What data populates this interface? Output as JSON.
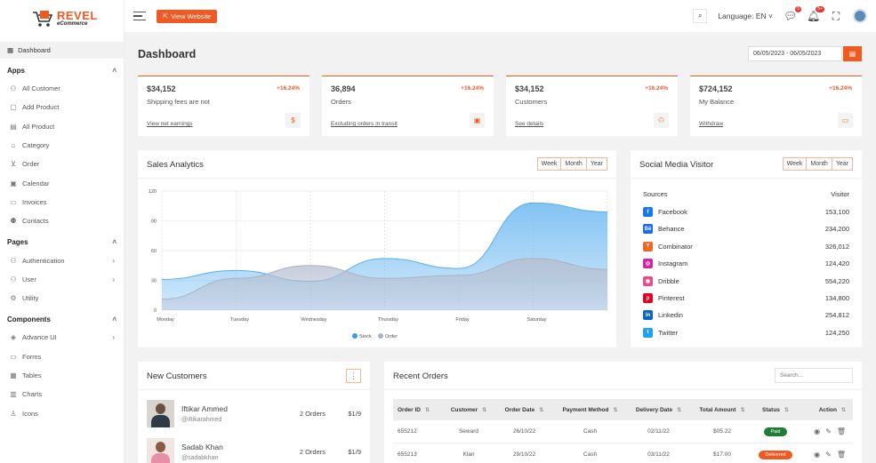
{
  "brand": {
    "name": "REVEL",
    "sub": "eCommerce"
  },
  "topbar": {
    "view_website": "View Website",
    "language_label": "Language:",
    "language_value": "EN",
    "messages_badge": "5",
    "notifications_badge": "5+"
  },
  "sidebar": {
    "dashboard": "Dashboard",
    "apps_title": "Apps",
    "apps": [
      "All Customer",
      "Add Product",
      "All Product",
      "Category",
      "Order",
      "Calendar",
      "Invoices",
      "Contacts"
    ],
    "pages_title": "Pages",
    "pages": [
      "Authentication",
      "User",
      "Utility"
    ],
    "components_title": "Components",
    "components": [
      "Advance UI",
      "Forms",
      "Tables",
      "Charts",
      "Icons"
    ]
  },
  "page": {
    "title": "Dashboard",
    "date_range": "06/05/2023 - 06/05/2023"
  },
  "stats": [
    {
      "value": "$34,152",
      "change": "+16.24%",
      "desc": "Shipping fees are not",
      "link": "View net earnings"
    },
    {
      "value": "36,894",
      "change": "+16.24%",
      "desc": "Orders",
      "link": "Excluding orders in transit"
    },
    {
      "value": "$34,152",
      "change": "+16.24%",
      "desc": "Customers",
      "link": "See details"
    },
    {
      "value": "$724,152",
      "change": "+16.24%",
      "desc": "My Balance",
      "link": "Withdraw"
    }
  ],
  "analytics": {
    "title": "Sales Analytics",
    "ranges": [
      "Week",
      "Month",
      "Year"
    ]
  },
  "chart_data": {
    "type": "area",
    "title": "Sales Analytics",
    "categories": [
      "Monday",
      "Tuesday",
      "Wednesday",
      "Thursday",
      "Friday",
      "Saturday",
      ""
    ],
    "y_ticks": [
      "120",
      "90",
      "60",
      "30",
      "0"
    ],
    "ylim": [
      0,
      120
    ],
    "series": [
      {
        "name": "Stock",
        "color": "#7cc0f2",
        "values": [
          31,
          40,
          29,
          52,
          42,
          108,
          99
        ]
      },
      {
        "name": "Order",
        "color": "#b7bfd0",
        "values": [
          11,
          32,
          45,
          32,
          35,
          52,
          41
        ]
      }
    ],
    "legend": "bottom",
    "grid": true
  },
  "social": {
    "title": "Social Media Visitor",
    "ranges": [
      "Week",
      "Month",
      "Year"
    ],
    "col_sources": "Sources",
    "col_visitor": "Visitor",
    "rows": [
      {
        "name": "Facebook",
        "value": "153,100",
        "color": "#1877f2",
        "glyph": "f"
      },
      {
        "name": "Behance",
        "value": "234,200",
        "color": "#1769ff",
        "glyph": "Bē"
      },
      {
        "name": "Combinator",
        "value": "326,012",
        "color": "#f26522",
        "glyph": "Y"
      },
      {
        "name": "Instagram",
        "value": "124,420",
        "color": "#d6249f",
        "glyph": "◎"
      },
      {
        "name": "Dribble",
        "value": "554,220",
        "color": "#ea4c89",
        "glyph": "◉"
      },
      {
        "name": "Pinterest",
        "value": "134,800",
        "color": "#e60023",
        "glyph": "p"
      },
      {
        "name": "Linkedin",
        "value": "254,812",
        "color": "#0a66c2",
        "glyph": "in"
      },
      {
        "name": "Twitter",
        "value": "124,250",
        "color": "#1da1f2",
        "glyph": "t"
      }
    ]
  },
  "new_customers": {
    "title": "New Customers",
    "rows": [
      {
        "name": "Iftikar Ammed",
        "handle": "@iftikarahmed",
        "orders": "2 Orders",
        "amount": "$1/9"
      },
      {
        "name": "Sadab Khan",
        "handle": "@sadabkhan",
        "orders": "2 Orders",
        "amount": "$1/9"
      }
    ]
  },
  "recent_orders": {
    "title": "Recent Orders",
    "search_placeholder": "Search...",
    "columns": [
      "Order ID",
      "Customer",
      "Order Date",
      "Payment Method",
      "Delivery Date",
      "Total Amount",
      "Status",
      "Action"
    ],
    "rows": [
      {
        "id": "655212",
        "customer": "Seward",
        "order_date": "26/10/22",
        "method": "Cash",
        "delivery": "02/11/22",
        "amount": "$05.22",
        "status": "Paid",
        "status_color": "#1e7e34"
      },
      {
        "id": "655213",
        "customer": "Klan",
        "order_date": "29/10/22",
        "method": "Cash",
        "delivery": "03/11/22",
        "amount": "$17.00",
        "status": "Delivered",
        "status_color": "#f05a22"
      }
    ]
  }
}
